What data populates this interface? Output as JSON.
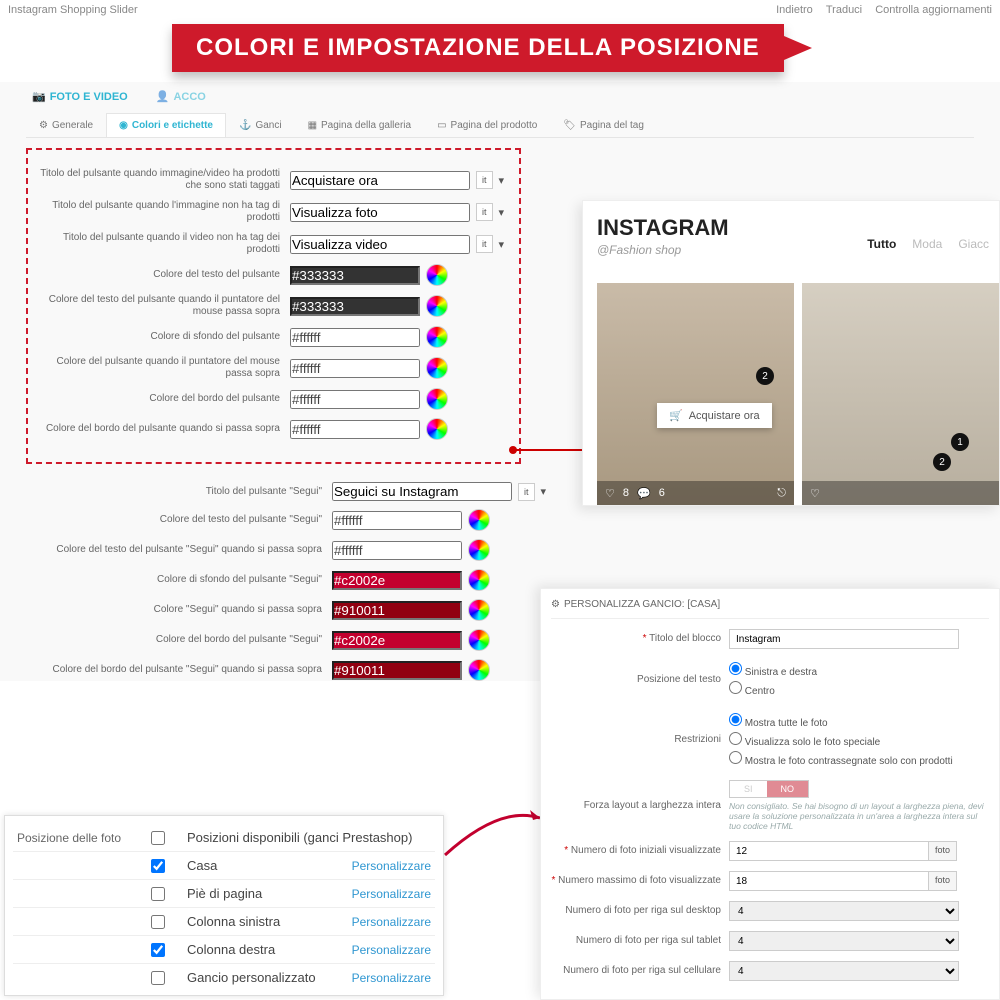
{
  "topbar": {
    "title": "Instagram Shopping Slider",
    "links": [
      "Indietro",
      "Traduci",
      "Controlla aggiornamenti"
    ]
  },
  "banner": "COLORI E IMPOSTAZIONE DELLA POSIZIONE",
  "maintabs": {
    "a": "FOTO E VIDEO",
    "b": "ACCO"
  },
  "subtabs": [
    "Generale",
    "Colori e etichette",
    "Ganci",
    "Pagina della galleria",
    "Pagina del prodotto",
    "Pagina del tag"
  ],
  "lang": "it",
  "labels": {
    "f1": "Titolo del pulsante quando immagine/video ha prodotti che sono stati taggati",
    "f2": "Titolo del pulsante quando l'immagine non ha tag di prodotti",
    "f3": "Titolo del pulsante quando il video non ha tag dei prodotti",
    "f4": "Colore del testo del pulsante",
    "f5": "Colore del testo del pulsante quando il puntatore del mouse passa sopra",
    "f6": "Colore di sfondo del pulsante",
    "f7": "Colore del pulsante quando il puntatore del mouse passa sopra",
    "f8": "Colore del bordo del pulsante",
    "f9": "Colore del bordo del pulsante quando si passa sopra",
    "s1": "Titolo del pulsante \"Segui\"",
    "s2": "Colore del testo del pulsante \"Segui\"",
    "s3": "Colore del testo del pulsante \"Segui\" quando si passa sopra",
    "s4": "Colore di sfondo del pulsante \"Segui\"",
    "s5": "Colore \"Segui\" quando si passa sopra",
    "s6": "Colore del bordo del pulsante \"Segui\"",
    "s7": "Colore del bordo del pulsante \"Segui\" quando si passa sopra"
  },
  "values": {
    "f1": "Acquistare ora",
    "f2": "Visualizza foto",
    "f3": "Visualizza video",
    "f4": "#333333",
    "f5": "#333333",
    "f6": "#ffffff",
    "f7": "#ffffff",
    "f8": "#ffffff",
    "f9": "#ffffff",
    "s1": "Seguici su Instagram",
    "s2": "#ffffff",
    "s3": "#ffffff",
    "s4": "#c2002e",
    "s5": "#910011",
    "s6": "#c2002e",
    "s7": "#910011"
  },
  "pos": {
    "title": "Posizione delle foto",
    "header": "Posizioni disponibili (ganci Prestashop)",
    "action": "Personalizzare",
    "rows": [
      {
        "name": "Casa",
        "checked": true
      },
      {
        "name": "Piè di pagina",
        "checked": false
      },
      {
        "name": "Colonna sinistra",
        "checked": false
      },
      {
        "name": "Colonna destra",
        "checked": true
      },
      {
        "name": "Gancio personalizzato",
        "checked": false
      }
    ]
  },
  "ig": {
    "title": "INSTAGRAM",
    "handle": "@Fashion shop",
    "filters": [
      "Tutto",
      "Moda",
      "Giacc"
    ],
    "pill": "Acquistare ora",
    "likes": "8",
    "comments": "6"
  },
  "hook": {
    "header": "PERSONALIZZA GANCIO: [CASA]",
    "l_title": "Titolo del blocco",
    "v_title": "Instagram",
    "l_pos": "Posizione del testo",
    "r1": "Sinistra e destra",
    "r2": "Centro",
    "l_rest": "Restrizioni",
    "rr1": "Mostra tutte le foto",
    "rr2": "Visualizza solo le foto speciale",
    "rr3": "Mostra le foto contrassegnate solo con prodotti",
    "l_full": "Forza layout a larghezza intera",
    "si": "SI",
    "no": "NO",
    "help": "Non consigliato. Se hai bisogno di un layout a larghezza piena, devi usare la soluzione personalizzata in un'area a larghezza intera sul tuo codice HTML",
    "l_init": "Numero di foto iniziali visualizzate",
    "v_init": "12",
    "l_max": "Numero massimo di foto visualizzate",
    "v_max": "18",
    "unit": "foto",
    "l_row_d": "Numero di foto per riga sul desktop",
    "l_row_t": "Numero di foto per riga sul tablet",
    "l_row_m": "Numero di foto per riga sul cellulare",
    "opt4": "4"
  }
}
